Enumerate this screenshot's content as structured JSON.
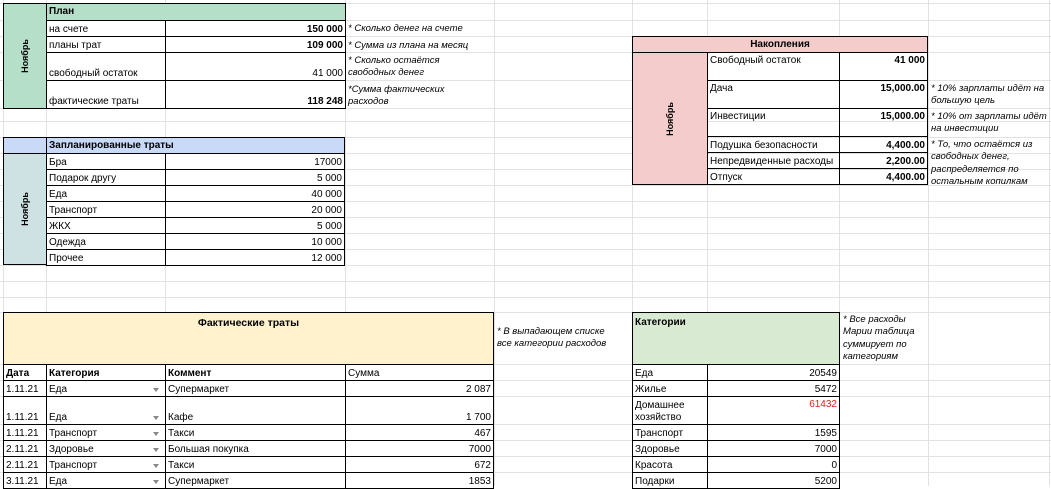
{
  "plan": {
    "title": "План",
    "month": "Ноябрь",
    "rows": [
      {
        "label": "на счете",
        "value": "150 000",
        "note": "* Сколько денег на счете"
      },
      {
        "label": "планы трат",
        "value": "109 000",
        "note": "* Сумма из плана на месяц"
      },
      {
        "label": "свободный остаток",
        "value": "41 000",
        "note": "* Сколько остаётся свободных денег"
      },
      {
        "label": "фактические траты",
        "value": "118 248",
        "note": "*Сумма фактических расходов"
      }
    ]
  },
  "planned": {
    "title": "Запланированные траты",
    "month": "Ноябрь",
    "rows": [
      {
        "label": "Бра",
        "value": "17000"
      },
      {
        "label": "Подарок другу",
        "value": "5 000"
      },
      {
        "label": "Еда",
        "value": "40 000"
      },
      {
        "label": "Транспорт",
        "value": "20 000"
      },
      {
        "label": "ЖКХ",
        "value": "5 000"
      },
      {
        "label": "Одежда",
        "value": "10 000"
      },
      {
        "label": "Прочее",
        "value": "12 000"
      }
    ]
  },
  "savings": {
    "title": "Накопления",
    "month": "Ноябрь",
    "rows": [
      {
        "label": "Свободный остаток",
        "value": "41 000"
      },
      {
        "label": "Дача",
        "value": "15,000.00"
      },
      {
        "label": "Инвестиции",
        "value": "15,000.00"
      },
      {
        "label": "Подушка безопасности",
        "value": "4,400.00"
      },
      {
        "label": "Непредвиденные расходы",
        "value": "2,200.00"
      },
      {
        "label": "Отпуск",
        "value": "4,400.00"
      }
    ],
    "notes": {
      "dacha": "* 10% зарплаты идёт на большую цель",
      "invest": "* 10% от зарплаты идёт на инвестиции",
      "rest": "* То, что остаётся из свободных денег, распределяется по остальным копилкам"
    }
  },
  "actual": {
    "title": "Фактические траты",
    "note": "* В выпадающем списке все категории расходов",
    "headers": {
      "date": "Дата",
      "category": "Категория",
      "comment": "Коммент",
      "sum": "Сумма"
    },
    "rows": [
      {
        "date": "1.11.21",
        "category": "Еда",
        "comment": "Супермаркет",
        "sum": "2 087"
      },
      {
        "date": "1.11.21",
        "category": "Еда",
        "comment": "Кафе",
        "sum": "1 700"
      },
      {
        "date": "1.11.21",
        "category": "Транспорт",
        "comment": "Такси",
        "sum": "467"
      },
      {
        "date": "2.11.21",
        "category": "Здоровье",
        "comment": "Большая покупка",
        "sum": "7000"
      },
      {
        "date": "2.11.21",
        "category": "Транспорт",
        "comment": "Такси",
        "sum": "672"
      },
      {
        "date": "3.11.21",
        "category": "Еда",
        "comment": "Супермаркет",
        "sum": "1853"
      }
    ]
  },
  "categories": {
    "title": "Категории",
    "note": "* Все расходы Марии таблица суммирует по категориям",
    "rows": [
      {
        "label": "Еда",
        "value": "20549"
      },
      {
        "label": "Жилье",
        "value": "5472"
      },
      {
        "label": "Домашнее хозяйство",
        "value": "61432"
      },
      {
        "label": "Транспорт",
        "value": "1595"
      },
      {
        "label": "Здоровье",
        "value": "7000"
      },
      {
        "label": "Красота",
        "value": "0"
      },
      {
        "label": "Подарки",
        "value": "5200"
      }
    ]
  },
  "colors": {
    "plan_header": "#b6dfca",
    "planned_header": "#c9daf8",
    "planned_side": "#cfe2e3",
    "savings": "#f4cccc",
    "actual_header": "#fff2cc",
    "categories_header": "#d9ead3",
    "red_value": "#e02020"
  }
}
